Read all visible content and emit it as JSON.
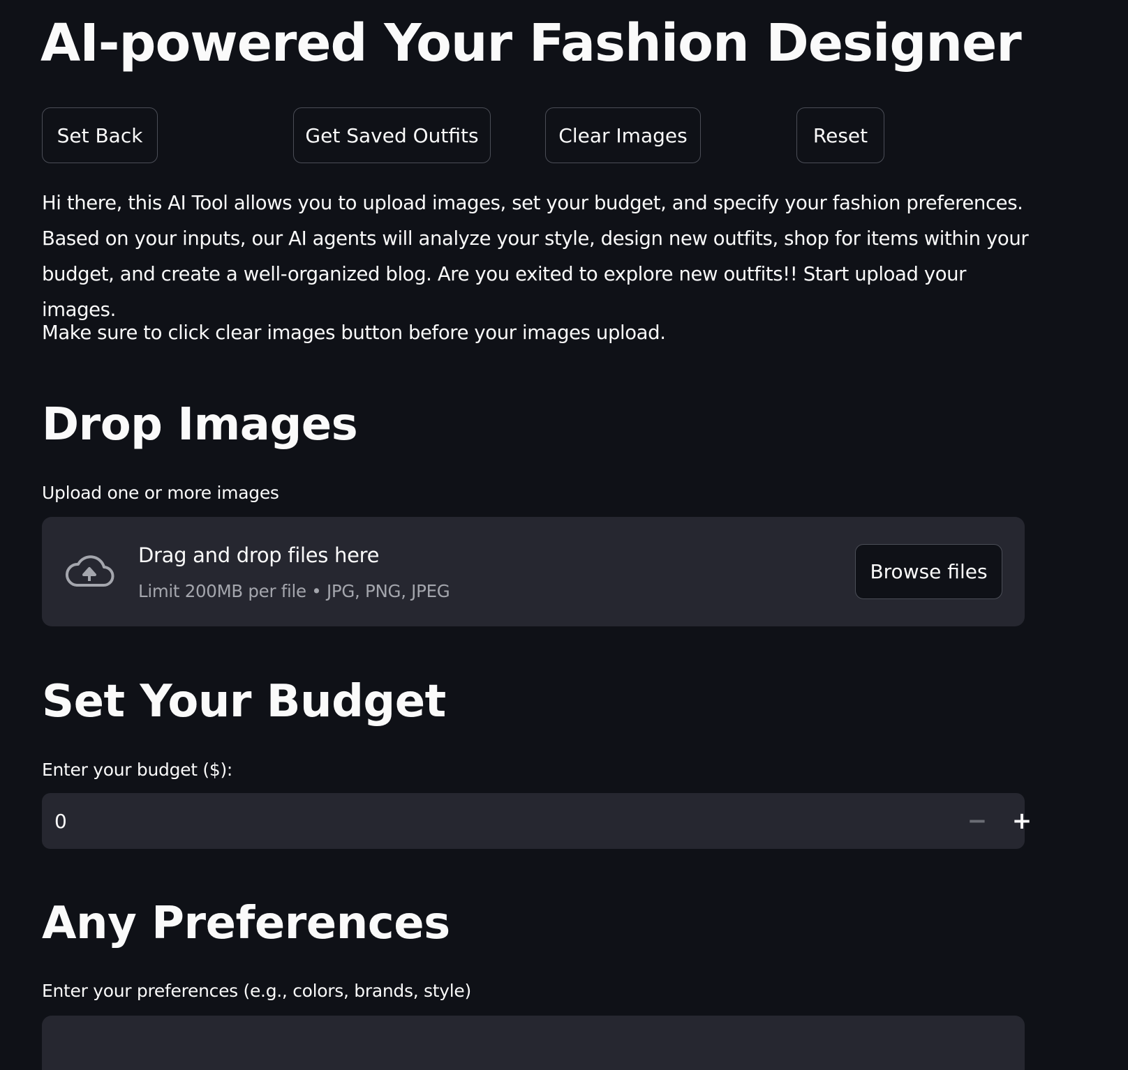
{
  "page": {
    "title": "AI-powered Your Fashion Designer"
  },
  "toolbar": {
    "set_back_label": "Set Back",
    "saved_outfits_label": "Get Saved Outfits",
    "clear_images_label": "Clear Images",
    "reset_label": "Reset"
  },
  "intro": {
    "paragraph": "Hi there, this AI Tool allows you to upload images, set your budget, and specify your fashion preferences. Based on your inputs, our AI agents will analyze your style, design new outfits, shop for items within your budget, and create a well-organized blog. Are you exited to explore new outfits!! Start upload your images.",
    "note": "Make sure to click clear images button before your images upload."
  },
  "upload": {
    "heading": "Drop Images",
    "label": "Upload one or more images",
    "drop_text": "Drag and drop files here",
    "limit_text": "Limit 200MB per file • JPG, PNG, JPEG",
    "browse_label": "Browse files",
    "icon": "cloud-upload-icon"
  },
  "budget": {
    "heading": "Set Your Budget",
    "label": "Enter your budget ($):",
    "value": "0",
    "decrement_symbol": "−",
    "increment_symbol": "+"
  },
  "preferences": {
    "heading": "Any Preferences",
    "label": "Enter your preferences (e.g., colors, brands, style)",
    "value": ""
  },
  "colors": {
    "background": "#0f1117",
    "surface": "#262730",
    "text": "#fafafa",
    "muted_text": "#a4a6ad",
    "border": "#4b4e57"
  }
}
